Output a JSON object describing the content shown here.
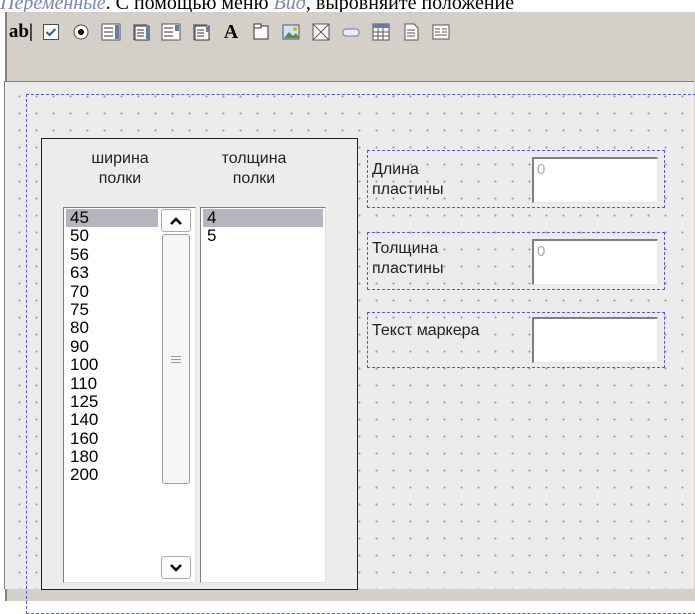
{
  "document": {
    "italic_word": "Переменные",
    "text": ". С помощью меню ",
    "italic_word2": "Вид",
    "text2": ", выровняйте положение"
  },
  "toolbar": {
    "textbox_glyph": "ab|",
    "label_glyph": "A",
    "icons": [
      "textbox-tool",
      "checkbox-tool",
      "radio-tool",
      "listbox-tool",
      "listbox-variant-tool",
      "combobox-tool",
      "combobox-variant-tool",
      "label-tool",
      "frame-tool",
      "image-tool",
      "placeholder-tool",
      "button-tool",
      "table-tool",
      "document-tool",
      "subform-tool"
    ]
  },
  "form": {
    "col1_label": "ширина полки",
    "col2_label": "толщина полки",
    "width_items": [
      "45",
      "50",
      "56",
      "63",
      "70",
      "75",
      "80",
      "90",
      "100",
      "110",
      "125",
      "140",
      "160",
      "180",
      "200"
    ],
    "thickness_items": [
      "4",
      "5"
    ],
    "selected_width": "45",
    "selected_thickness": "4",
    "plate_length_label": "Длина пластины",
    "plate_length_value": "0",
    "plate_thickness_label": "Толщина пластины",
    "plate_thickness_value": "0",
    "marker_text_label": "Текст маркера",
    "marker_text_value": ""
  },
  "colors": {
    "face": "#d4d0c8",
    "selection_dash": "#5a5ad8",
    "listbox_selected": "#b5b5c0"
  }
}
